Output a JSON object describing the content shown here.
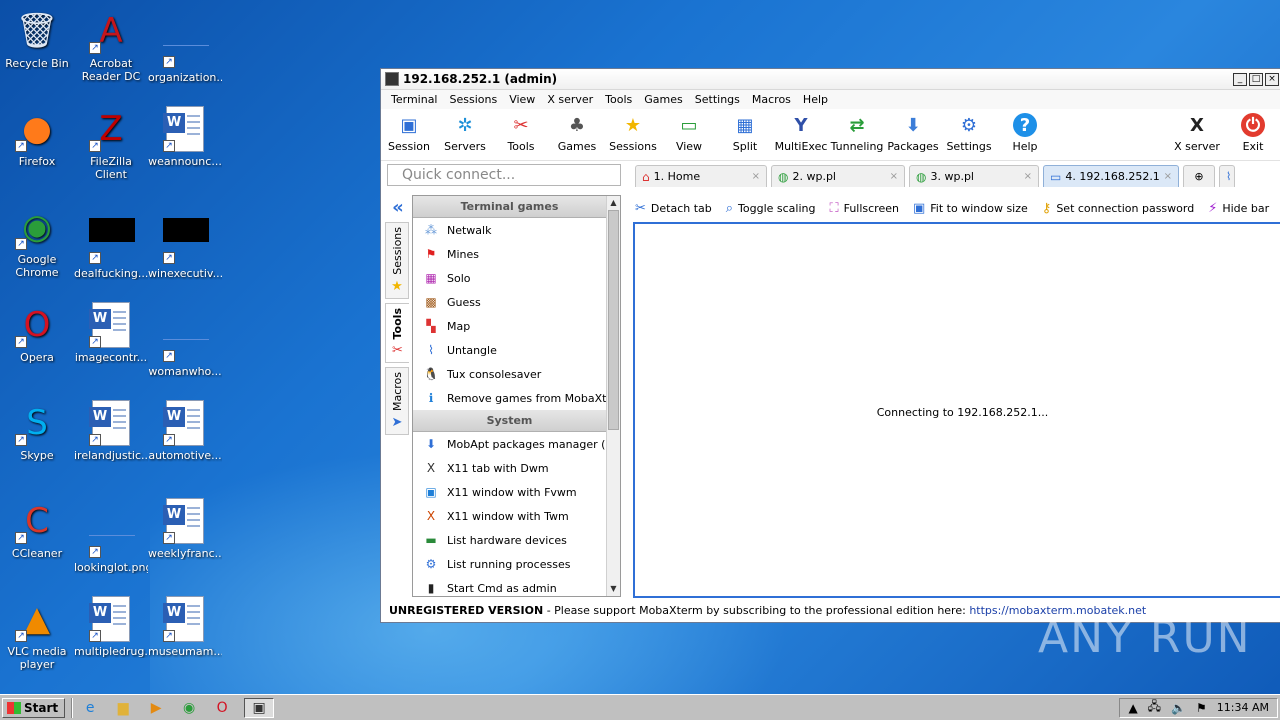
{
  "desktop_icons": [
    {
      "label": "Recycle Bin",
      "icon": "recycle-bin-icon"
    },
    {
      "label": "Acrobat Reader DC",
      "icon": "acrobat-icon"
    },
    {
      "label": "organization...",
      "icon": "blank-file-icon"
    },
    {
      "label": "Firefox",
      "icon": "firefox-icon"
    },
    {
      "label": "FileZilla Client",
      "icon": "filezilla-icon"
    },
    {
      "label": "weannounc...",
      "icon": "word-doc-icon"
    },
    {
      "label": "Google Chrome",
      "icon": "chrome-icon"
    },
    {
      "label": "dealfucking...",
      "icon": "black-thumb-icon"
    },
    {
      "label": "winexecutiv...",
      "icon": "black-thumb-icon"
    },
    {
      "label": "Opera",
      "icon": "opera-icon"
    },
    {
      "label": "imagecontr...",
      "icon": "word-doc-icon"
    },
    {
      "label": "womanwho...",
      "icon": "blank-file-icon"
    },
    {
      "label": "Skype",
      "icon": "skype-icon"
    },
    {
      "label": "irelandjustic...",
      "icon": "word-doc-icon"
    },
    {
      "label": "automotive...",
      "icon": "word-doc-icon"
    },
    {
      "label": "CCleaner",
      "icon": "ccleaner-icon"
    },
    {
      "label": "lookinglot.png",
      "icon": "blank-file-icon"
    },
    {
      "label": "weeklyfranc...",
      "icon": "word-doc-icon"
    },
    {
      "label": "VLC media player",
      "icon": "vlc-icon"
    },
    {
      "label": "multipledrug...",
      "icon": "word-doc-icon"
    },
    {
      "label": "museumam...",
      "icon": "word-doc-icon"
    }
  ],
  "window": {
    "title": "192.168.252.1 (admin)",
    "menu": [
      "Terminal",
      "Sessions",
      "View",
      "X server",
      "Tools",
      "Games",
      "Settings",
      "Macros",
      "Help"
    ],
    "toolbar": [
      {
        "label": "Session",
        "icon": "session-icon"
      },
      {
        "label": "Servers",
        "icon": "servers-icon"
      },
      {
        "label": "Tools",
        "icon": "tools-icon"
      },
      {
        "label": "Games",
        "icon": "games-icon"
      },
      {
        "label": "Sessions",
        "icon": "star-icon"
      },
      {
        "label": "View",
        "icon": "view-icon"
      },
      {
        "label": "Split",
        "icon": "split-icon"
      },
      {
        "label": "MultiExec",
        "icon": "multiexec-icon"
      },
      {
        "label": "Tunneling",
        "icon": "tunneling-icon"
      },
      {
        "label": "Packages",
        "icon": "packages-icon"
      },
      {
        "label": "Settings",
        "icon": "settings-gear-icon"
      },
      {
        "label": "Help",
        "icon": "help-icon"
      },
      {
        "label": "X server",
        "icon": "x-server-icon"
      },
      {
        "label": "Exit",
        "icon": "power-icon"
      }
    ],
    "quick_connect_placeholder": "Quick connect...",
    "side_tabs": [
      "Sessions",
      "Tools",
      "Macros"
    ],
    "tool_sections": [
      {
        "header": "Terminal games",
        "items": [
          {
            "label": "Netwalk",
            "icon": "netwalk-icon"
          },
          {
            "label": "Mines",
            "icon": "flag-icon"
          },
          {
            "label": "Solo",
            "icon": "solo-icon"
          },
          {
            "label": "Guess",
            "icon": "guess-icon"
          },
          {
            "label": "Map",
            "icon": "map-icon"
          },
          {
            "label": "Untangle",
            "icon": "paperclip-icon"
          },
          {
            "label": "Tux consolesaver",
            "icon": "tux-icon"
          },
          {
            "label": "Remove games from MobaXterm",
            "icon": "info-icon"
          }
        ]
      },
      {
        "header": "System",
        "items": [
          {
            "label": "MobApt packages manager (expe",
            "icon": "download-icon"
          },
          {
            "label": "X11 tab with Dwm",
            "icon": "x11-icon"
          },
          {
            "label": "X11 window with Fvwm",
            "icon": "window-icon"
          },
          {
            "label": "X11 window with Twm",
            "icon": "x-icon"
          },
          {
            "label": "List hardware devices",
            "icon": "hardware-icon"
          },
          {
            "label": "List running processes",
            "icon": "process-icon"
          },
          {
            "label": "Start Cmd as admin",
            "icon": "cmd-icon"
          }
        ]
      }
    ],
    "tabs": [
      {
        "label": "1. Home",
        "icon": "home-icon",
        "active": false
      },
      {
        "label": "2. wp.pl",
        "icon": "globe-icon",
        "active": false
      },
      {
        "label": "3. wp.pl",
        "icon": "globe-icon",
        "active": false
      },
      {
        "label": "4. 192.168.252.1",
        "icon": "monitor-icon",
        "active": true
      }
    ],
    "tab_actions": [
      {
        "label": "Detach tab",
        "icon": "scissors-icon"
      },
      {
        "label": "Toggle scaling",
        "icon": "magnifier-icon"
      },
      {
        "label": "Fullscreen",
        "icon": "fullscreen-icon"
      },
      {
        "label": "Fit to window size",
        "icon": "fit-window-icon"
      },
      {
        "label": "Set connection password",
        "icon": "key-icon"
      },
      {
        "label": "Hide bar",
        "icon": "bolt-icon"
      }
    ],
    "terminal_status": "Connecting to 192.168.252.1...",
    "status": {
      "unregistered": "UNREGISTERED VERSION",
      "message": " -  Please support MobaXterm by subscribing to the professional edition here: ",
      "link": "https://mobaxterm.mobatek.net"
    }
  },
  "watermark": "ANY RUN",
  "taskbar": {
    "start_label": "Start",
    "clock": "11:34 AM"
  },
  "colors": {
    "accent": "#2f6fd6",
    "desktop": "#1a73d1"
  }
}
